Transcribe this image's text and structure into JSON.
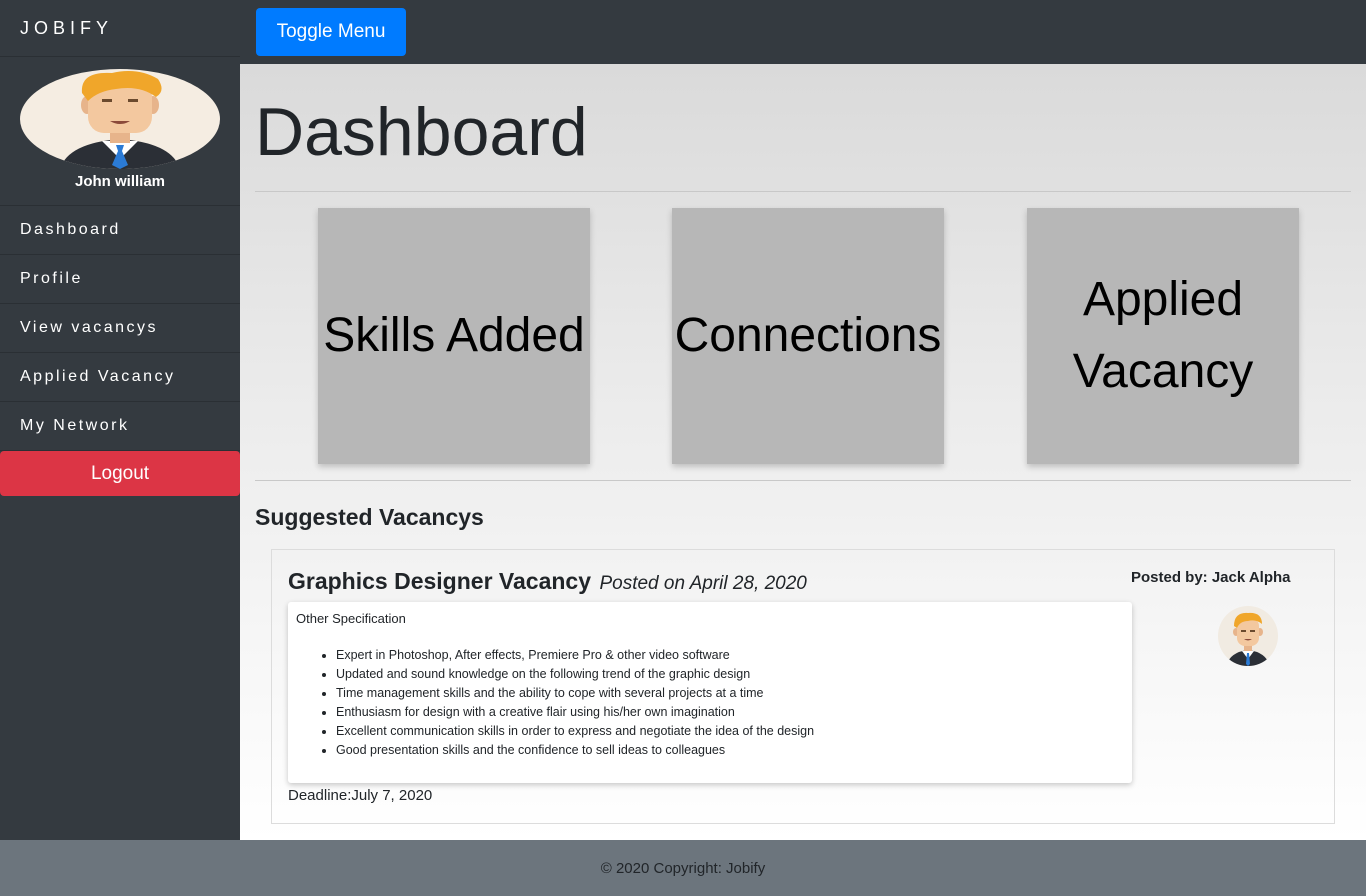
{
  "app": {
    "brand": "JOBIFY"
  },
  "topbar": {
    "toggle_label": "Toggle Menu"
  },
  "sidebar": {
    "user_name": "John william",
    "items": [
      {
        "label": "Dashboard"
      },
      {
        "label": "Profile"
      },
      {
        "label": "View vacancys"
      },
      {
        "label": "Applied Vacancy"
      },
      {
        "label": "My Network"
      }
    ],
    "logout_label": "Logout"
  },
  "main": {
    "title": "Dashboard",
    "stats": [
      {
        "label": "Skills Added"
      },
      {
        "label": "Connections"
      },
      {
        "label": "Applied Vacancy"
      }
    ],
    "section_title": "Suggested Vacancys",
    "vacancy": {
      "title": "Graphics Designer Vacancy",
      "posted_on": "Posted on April 28, 2020",
      "spec_title": "Other Specification",
      "specs": [
        "Expert in Photoshop, After effects, Premiere Pro & other video software",
        "Updated and sound knowledge on the following trend of the graphic design",
        "Time management skills and the ability to cope with several projects at a time",
        "Enthusiasm for design with a creative flair using his/her own imagination",
        "Excellent communication skills in order to express and negotiate the idea of the design",
        "Good presentation skills and the confidence to sell ideas to colleagues"
      ],
      "deadline": "Deadline:July 7, 2020",
      "posted_by": "Posted by: Jack Alpha"
    }
  },
  "footer": {
    "text": "© 2020 Copyright: Jobify"
  },
  "colors": {
    "sidebar_bg": "#343a40",
    "primary": "#007bff",
    "danger": "#dc3545",
    "footer_bg": "#6c757d",
    "stat_box": "#b7b7b7"
  }
}
